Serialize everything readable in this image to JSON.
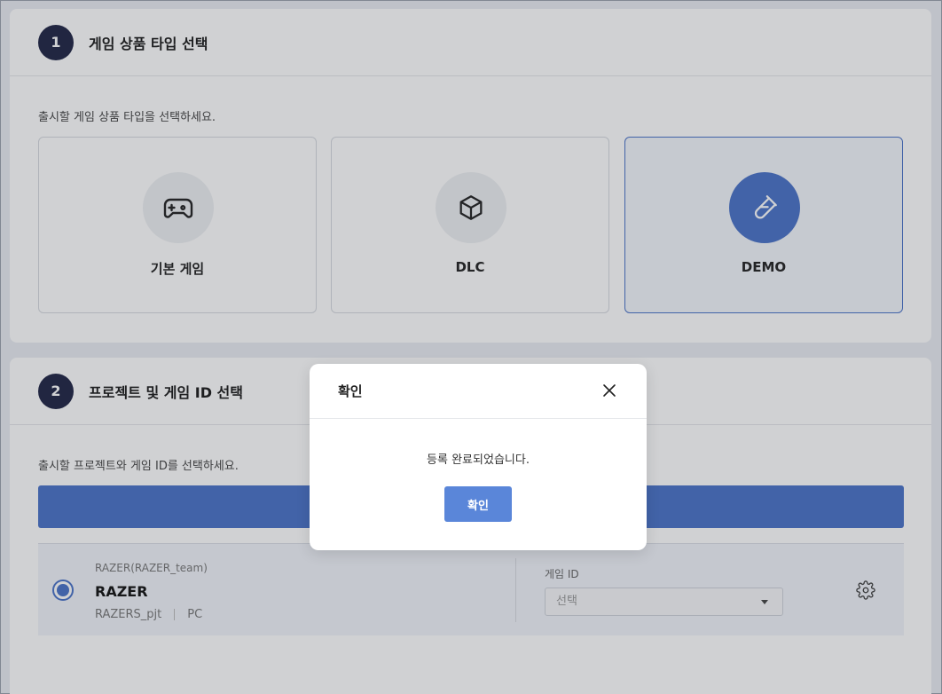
{
  "step1": {
    "number": "1",
    "title": "게임 상품 타입 선택",
    "description": "출시할 게임 상품 타입을 선택하세요.",
    "cards": [
      {
        "label": "기본 게임",
        "icon": "gamepad-icon"
      },
      {
        "label": "DLC",
        "icon": "cube-icon"
      },
      {
        "label": "DEMO",
        "icon": "test-tube-icon",
        "selected": true
      }
    ]
  },
  "step2": {
    "number": "2",
    "title": "프로젝트 및 게임 ID 선택",
    "description": "출시할 프로젝트와 게임 ID를 선택하세요.",
    "project": {
      "team": "RAZER(RAZER_team)",
      "name": "RAZER",
      "code": "RAZERS_pjt",
      "platform": "PC"
    },
    "game_id": {
      "label": "게임 ID",
      "placeholder": "선택"
    }
  },
  "modal": {
    "title": "확인",
    "message": "등록 완료되었습니다.",
    "confirm_label": "확인"
  },
  "colors": {
    "accent": "#4a72c8",
    "badge": "#1f2545",
    "button": "#5a86d9"
  }
}
